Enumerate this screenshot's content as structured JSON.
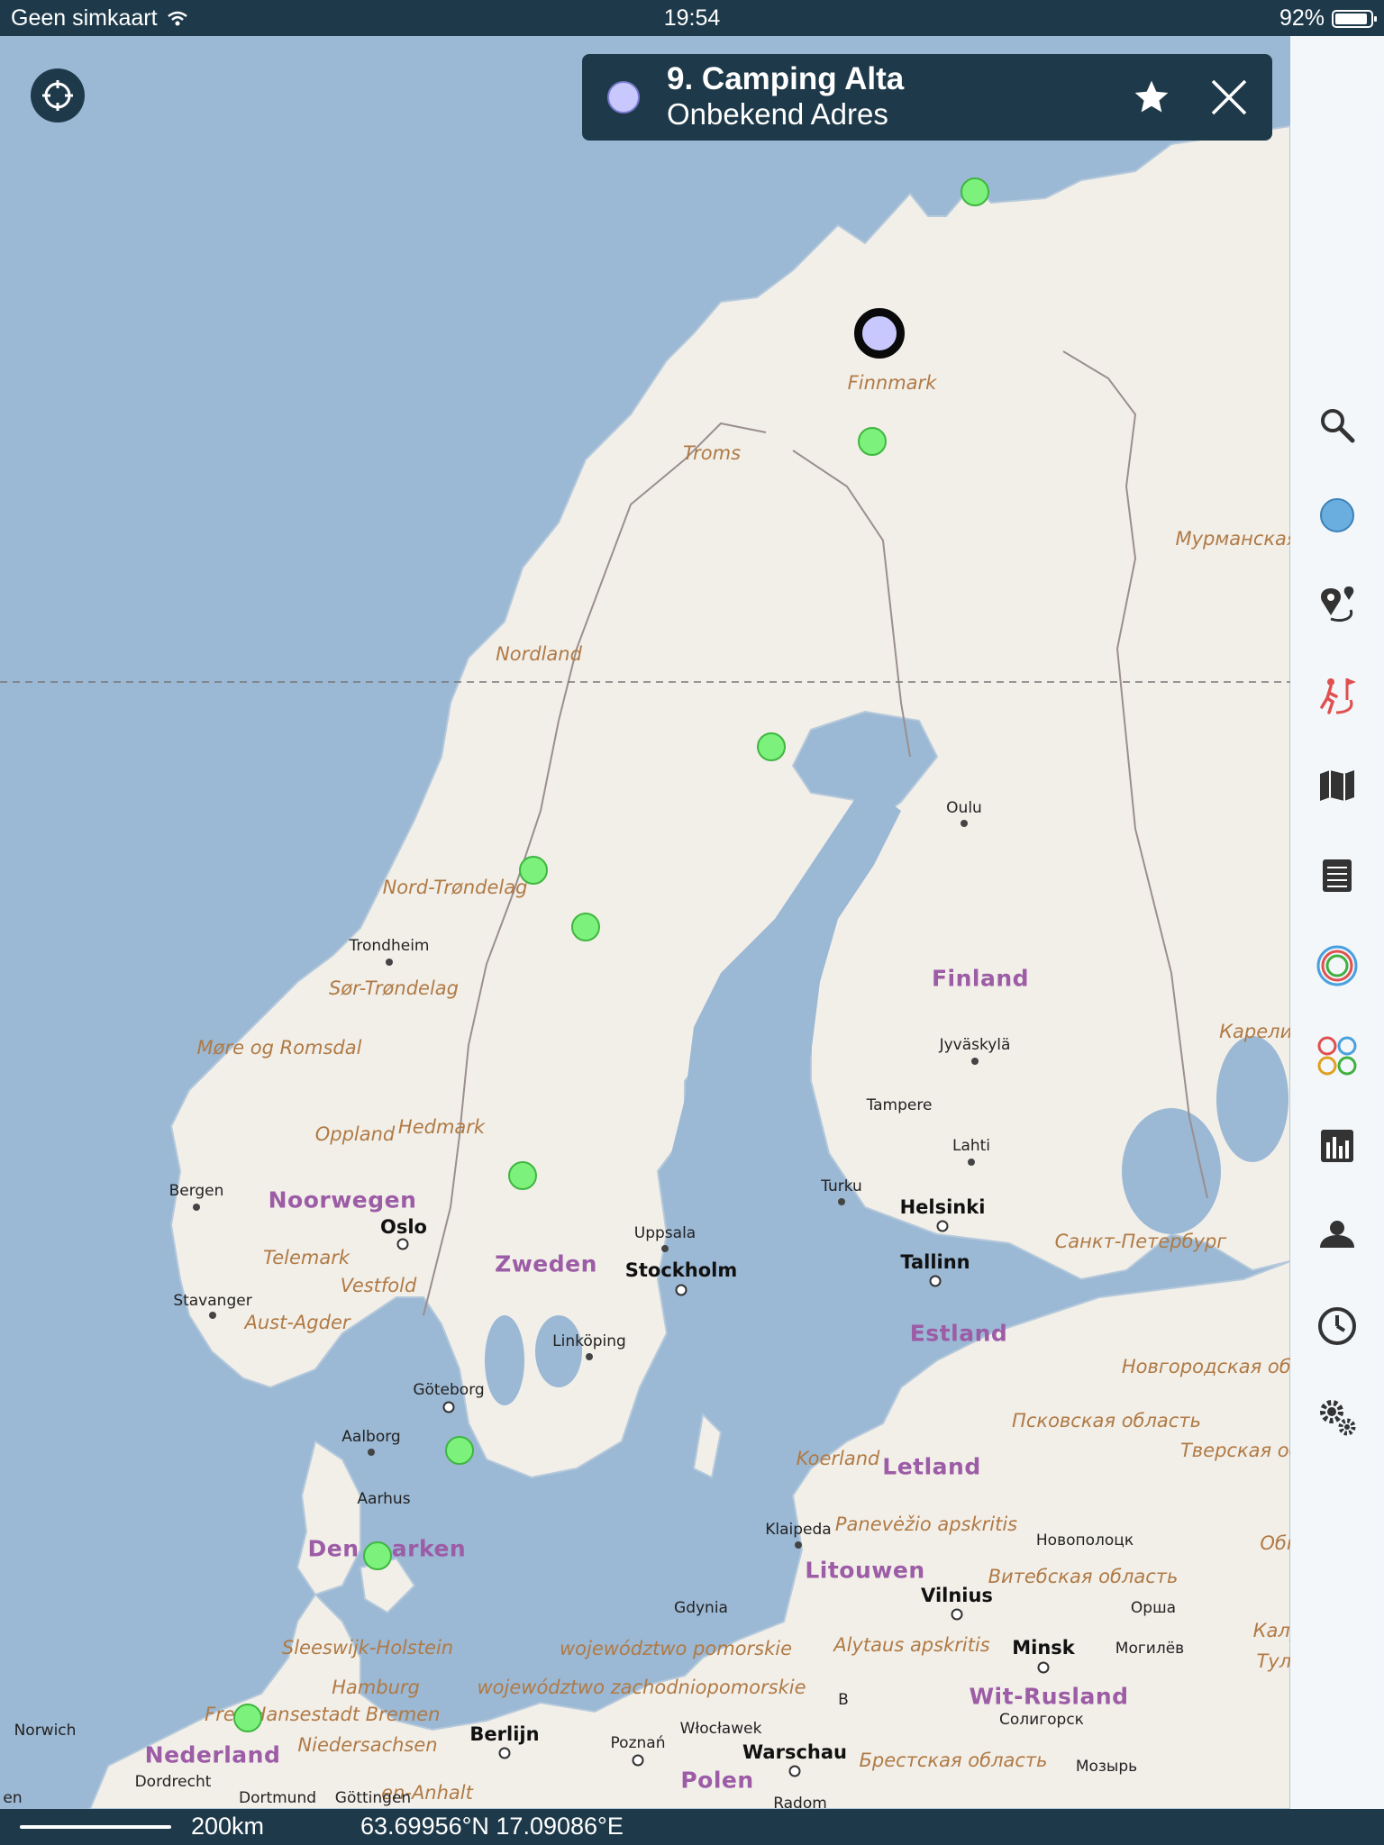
{
  "status_bar": {
    "carrier": "Geen simkaart",
    "time": "19:54",
    "battery_text": "92%",
    "battery_level": 0.92
  },
  "info_card": {
    "title": "9. Camping Alta",
    "subtitle": "Onbekend Adres"
  },
  "bottom_bar": {
    "scale": "200km",
    "coordinates": "63.69956°N 17.09086°E"
  },
  "sidebar_icons": [
    "search-icon",
    "location-dot-icon",
    "route-pins-icon",
    "hiking-icon",
    "map-icon",
    "list-icon",
    "tracks-icon",
    "layers-icon",
    "chart-icon",
    "person-icon",
    "clock-icon",
    "settings-icon"
  ],
  "map": {
    "regions": [
      "Finnmark",
      "Troms",
      "Nordland",
      "Nord-Trøndelag",
      "Sør-Trøndelag",
      "Møre og Romsdal",
      "Oppland",
      "Hedmark",
      "Telemark",
      "Vestfold",
      "Aust-Agder",
      "Sleeswijk-Holstein",
      "Hamburg",
      "województwo pomorskie",
      "województwo zachodniopomorskie",
      "Hansestadt Bremen",
      "Niedersachsen",
      "Panevėžio apskritis",
      "Alytaus apskritis",
      "Мурманская область",
      "Карелия",
      "Новгородская область",
      "Псковская область",
      "Тверская область",
      "Витебская область",
      "Брестская область",
      "Калужская об",
      "Fre",
      "en-Anhalt",
      "Обн",
      "Туль"
    ],
    "countries": [
      "Noorwegen",
      "Zweden",
      "Finland",
      "Estland",
      "Letland",
      "Litouwen",
      "Wit-Rusland",
      "Den",
      "arken",
      "Nederland",
      "Polen",
      "Koerland"
    ],
    "cities": [
      "Trondheim",
      "Bergen",
      "Stavanger",
      "Uppsala",
      "Linköping",
      "Göteborg",
      "Aalborg",
      "Aarhus",
      "Oulu",
      "Jyväskylä",
      "Tampere",
      "Lahti",
      "Turku",
      "Klaipeda",
      "Gdynia",
      "Новополоцк",
      "Орша",
      "Могилёв",
      "Солигорск",
      "Мозырь",
      "Norwich",
      "Dordrecht",
      "Dortmund",
      "Göttingen",
      "Poznań",
      "Włocławek",
      "Radom",
      "B",
      "en"
    ],
    "capitals": [
      "Oslo",
      "Stockholm",
      "Helsinki",
      "Tallinn",
      "Vilnius",
      "Minsk",
      "Berlijn",
      "Warschau",
      "Санкт-Петербург"
    ]
  },
  "colors": {
    "bar": "#1e3a4a",
    "water": "#9bb8d4",
    "land": "#f2efe9",
    "marker": "#7cf27c",
    "selected": "#c8c8ff",
    "region_label": "#b07a45",
    "country_label": "#9c5ca6"
  }
}
